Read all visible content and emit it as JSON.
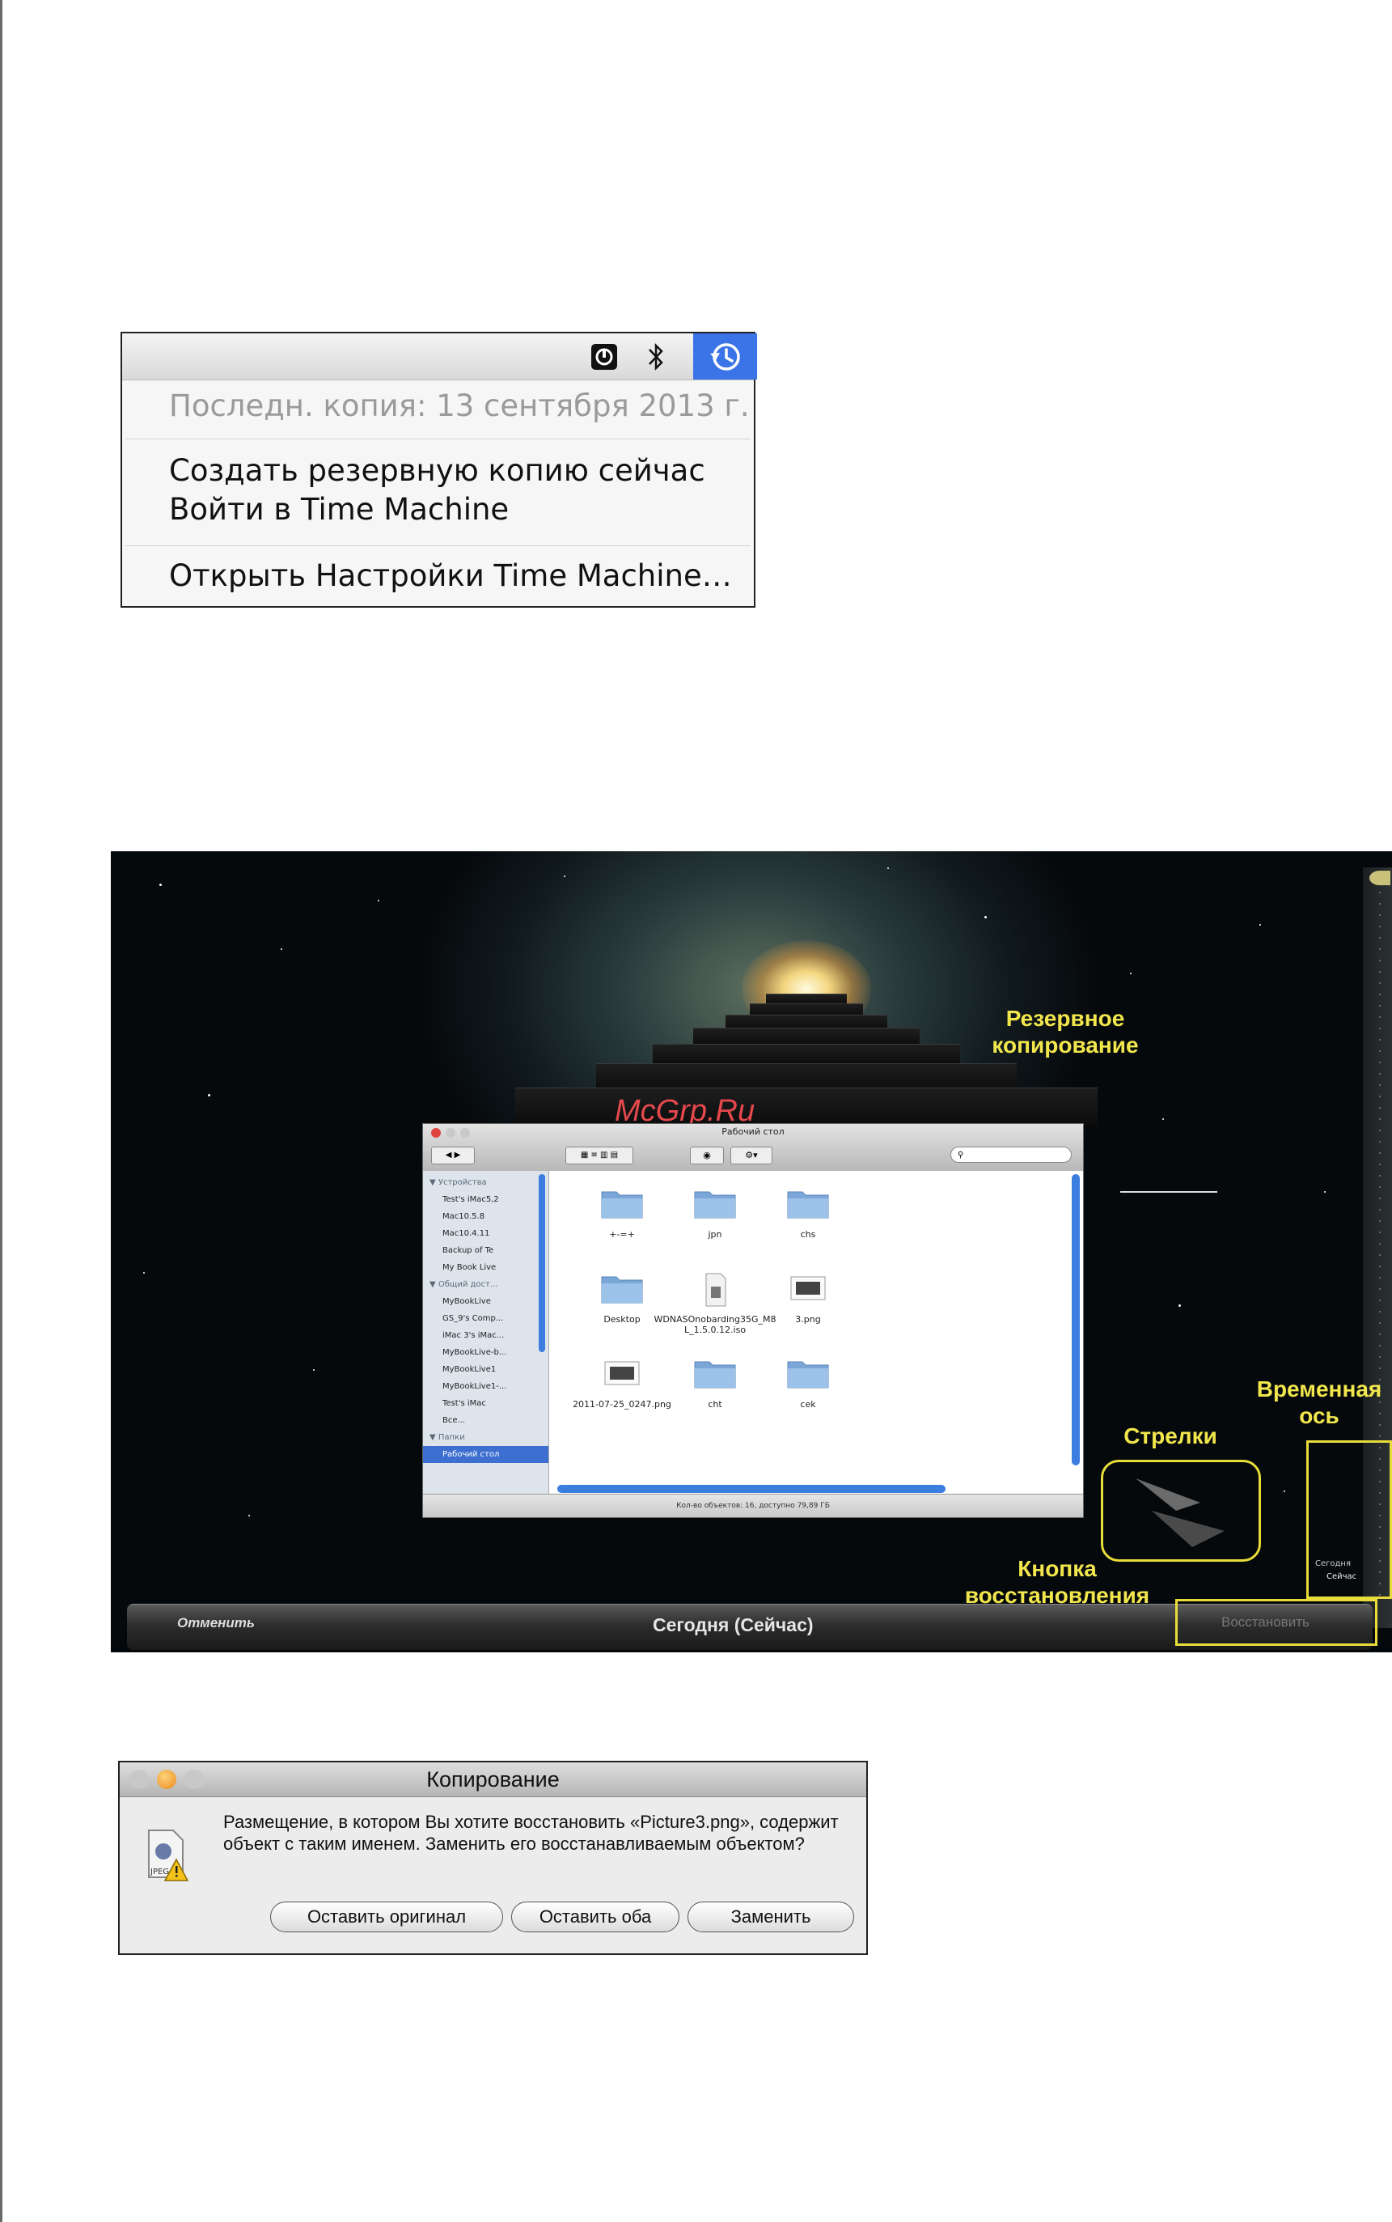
{
  "menu": {
    "last_backup": "Последн. копия: 13 сентября 2013 г.",
    "backup_now": "Создать резервную копию сейчас",
    "enter_tm": "Войти в Time Machine",
    "open_prefs": "Открыть Настройки Time Machine…",
    "icons": [
      "drive-icon",
      "bluetooth-icon",
      "time-machine-icon"
    ]
  },
  "timemachine": {
    "watermark": "McGrp.Ru",
    "callouts": {
      "backup": "Резервное копирование",
      "arrows": "Стрелки",
      "timeline": "Временная ось",
      "restore_button": "Кнопка восстановления"
    },
    "timeline_labels": {
      "today": "Сегодня",
      "now": "Сейчас"
    },
    "bottombar": {
      "cancel": "Отменить",
      "today_now": "Сегодня (Сейчас)",
      "restore": "Восстановить"
    },
    "finder": {
      "title": "Рабочий стол",
      "sidebar": {
        "devices_header": "▼ Устройства",
        "devices": [
          "Test's iMac5,2",
          "Mac10.5.8",
          "Mac10.4.11",
          "Backup of Te",
          "My Book Live"
        ],
        "shared_header": "▼ Общий дост...",
        "shared": [
          "MyBookLive",
          "GS_9's Comp...",
          "iMac 3's iMac...",
          "MyBookLive-b...",
          "MyBookLive1",
          "MyBookLive1-...",
          "Test's iMac",
          "Все..."
        ],
        "places_header": "▼ Папки",
        "places": [
          "Рабочий стол"
        ]
      },
      "files": [
        {
          "name": "+-=+",
          "kind": "folder"
        },
        {
          "name": "jpn",
          "kind": "folder"
        },
        {
          "name": "chs",
          "kind": "folder"
        },
        {
          "name": "Desktop",
          "kind": "folder"
        },
        {
          "name": "WDNASOnobarding35G_M8 L_1.5.0.12.iso",
          "kind": "file"
        },
        {
          "name": "3.png",
          "kind": "image"
        },
        {
          "name": "2011-07-25_0247.png",
          "kind": "image"
        },
        {
          "name": "cht",
          "kind": "folder"
        },
        {
          "name": "cek",
          "kind": "folder"
        }
      ],
      "status": "Кол-во объектов: 16, доступно 79,89 ГБ"
    }
  },
  "dialog": {
    "title": "Копирование",
    "message": "Размещение, в котором Вы хотите восстановить «Picture3.png», содержит объект с таким именем. Заменить его восстанавливаемым объектом?",
    "buttons": {
      "keep_original": "Оставить оригинал",
      "keep_both": "Оставить оба",
      "replace": "Заменить"
    }
  }
}
